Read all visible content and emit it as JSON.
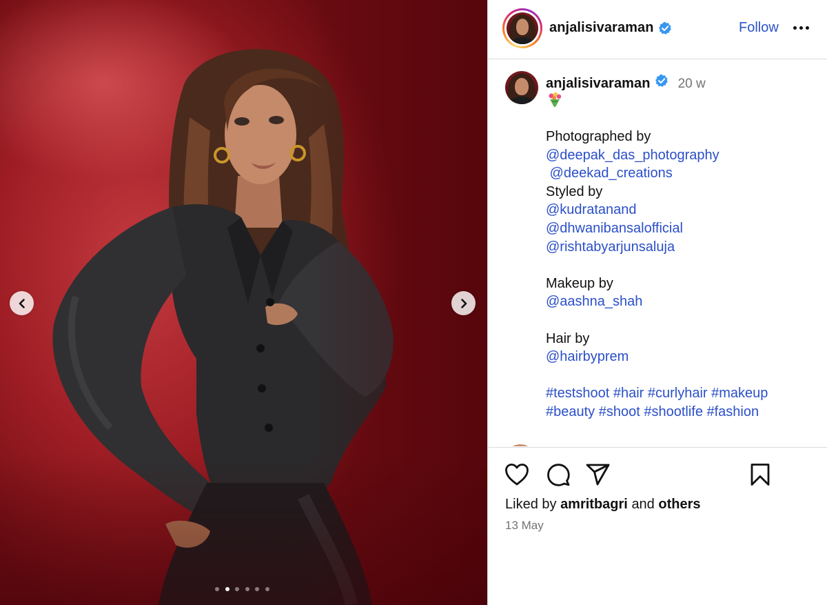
{
  "post": {
    "author": "anjalisivaraman",
    "verified": true,
    "follow_label": "Follow",
    "more_icon": "more-horizontal-icon",
    "carousel": {
      "total_slides": 6,
      "active_index": 1,
      "prev_icon": "chevron-left-icon",
      "next_icon": "chevron-right-icon"
    }
  },
  "caption": {
    "author": "anjalisivaraman",
    "time_ago": "20 w",
    "emoji": "bouquet-emoji",
    "lines": [
      {
        "text": "Photographed by",
        "link": false
      },
      {
        "text": "@deepak_das_photography",
        "link": true
      },
      {
        "text": " @deekad_creations",
        "link": true
      },
      {
        "text": "Styled by",
        "link": false
      },
      {
        "text": "@kudratanand",
        "link": true
      },
      {
        "text": "@dhwanibansalofficial",
        "link": true
      },
      {
        "text": "@rishtabyarjunsaluja",
        "link": true
      },
      {
        "text": "",
        "link": false
      },
      {
        "text": "Makeup by",
        "link": false
      },
      {
        "text": "@aashna_shah",
        "link": true
      },
      {
        "text": "",
        "link": false
      },
      {
        "text": "Hair by",
        "link": false
      },
      {
        "text": "@hairbyprem",
        "link": true
      },
      {
        "text": "",
        "link": false
      },
      {
        "text": "#testshoot #hair #curlyhair #makeup",
        "link": true
      },
      {
        "text": "#beauty #shoot #shootlife #fashion",
        "link": true
      }
    ]
  },
  "actions": {
    "icons": [
      "heart-icon",
      "comment-icon",
      "share-icon",
      "bookmark-icon"
    ],
    "liked_by_prefix": "Liked by",
    "liked_by_user": "amritbagri",
    "liked_by_joiner": "and",
    "liked_by_others": "others",
    "date": "13 May"
  },
  "colors": {
    "link": "#2b4fc8",
    "follow": "#2b54c8",
    "verified_badge": "#3897f0",
    "muted_text": "#737373",
    "divider": "#dbdbdb",
    "photo_background": "#9e1d24"
  }
}
